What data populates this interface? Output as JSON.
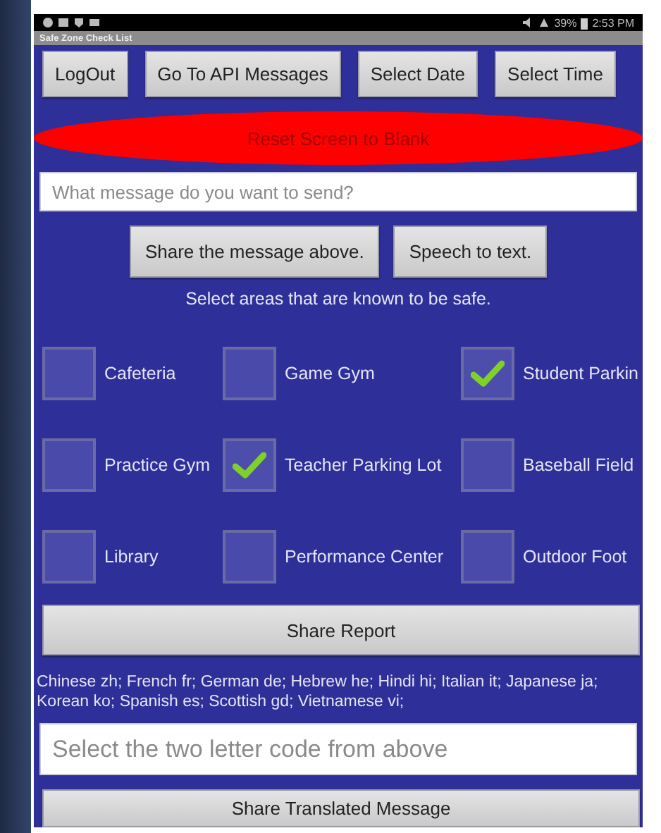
{
  "status_bar": {
    "battery": "39%",
    "time": "2:53 PM"
  },
  "app_title": "Safe Zone Check List",
  "top_buttons": [
    "LogOut",
    "Go To API Messages",
    "Select Date",
    "Select Time"
  ],
  "reset_button": "Reset Screen to Blank",
  "message_field": {
    "placeholder": "What message do you want to send?"
  },
  "message_buttons": [
    "Share the message above.",
    "Speech to text."
  ],
  "areas_prompt": "Select areas that are known to be safe.",
  "areas": [
    {
      "label": "Cafeteria",
      "checked": false
    },
    {
      "label": "Game Gym",
      "checked": false
    },
    {
      "label": "Student Parkin",
      "checked": true
    },
    {
      "label": "Practice Gym",
      "checked": false
    },
    {
      "label": "Teacher Parking Lot",
      "checked": true
    },
    {
      "label": "Baseball Field",
      "checked": false
    },
    {
      "label": "Library",
      "checked": false
    },
    {
      "label": "Performance Center",
      "checked": false
    },
    {
      "label": "Outdoor Foot",
      "checked": false
    }
  ],
  "share_report_button": "Share Report",
  "language_codes": "Chinese zh; French fr; German de; Hebrew he; Hindi hi; Italian it; Japanese ja; Korean ko; Spanish es; Scottish gd; Vietnamese vi;",
  "language_field": {
    "placeholder": "Select the two letter code from above"
  },
  "translate_button": "Share Translated Message"
}
